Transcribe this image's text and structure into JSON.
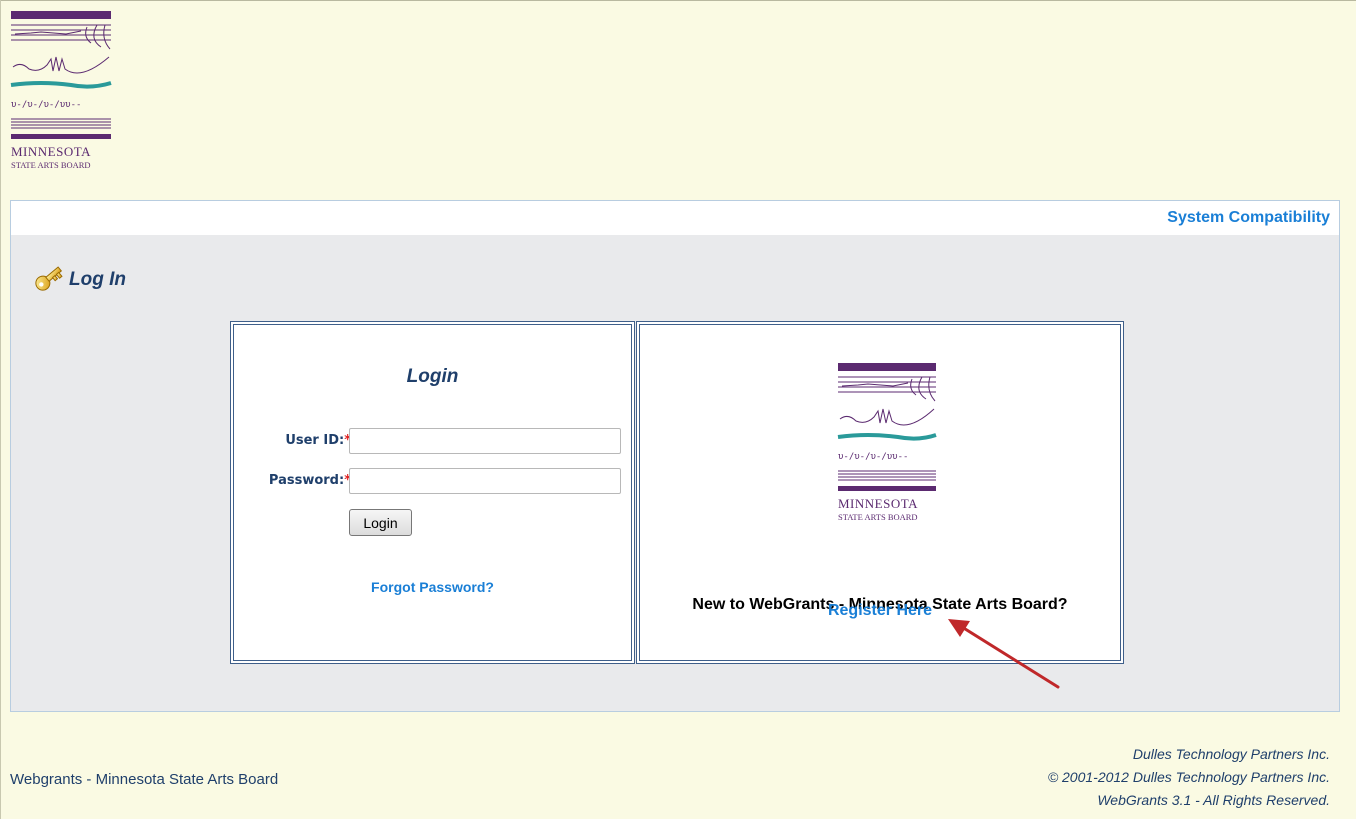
{
  "logo": {
    "line1": "MINNESOTA",
    "line2": "STATE ARTS BOARD",
    "brand_colors": {
      "purple": "#5b2a70",
      "teal": "#2a9a9a"
    }
  },
  "nav": {
    "system_compatibility": "System Compatibility"
  },
  "page": {
    "title": "Log In",
    "icon": "key-icon"
  },
  "login": {
    "title": "Login",
    "user_id_label": "User ID:",
    "password_label": "Password:",
    "required_marker": "*",
    "user_id_value": "",
    "password_value": "",
    "button_label": "Login",
    "forgot_password": "Forgot Password?"
  },
  "register": {
    "prompt": "New to WebGrants - Minnesota State Arts Board?",
    "link": "Register Here"
  },
  "footer": {
    "left": "Webgrants - Minnesota State Arts Board",
    "company": "Dulles Technology Partners Inc.",
    "copyright": "© 2001-2012 Dulles Technology Partners Inc.",
    "rights": "WebGrants 3.1 - All Rights Reserved."
  },
  "colors": {
    "link": "#1a7fd6",
    "heading": "#1f3f6b",
    "page_bg": "#fafae3",
    "panel_bg": "#e9eaec",
    "required": "#e02020",
    "arrow": "#c0282a"
  }
}
